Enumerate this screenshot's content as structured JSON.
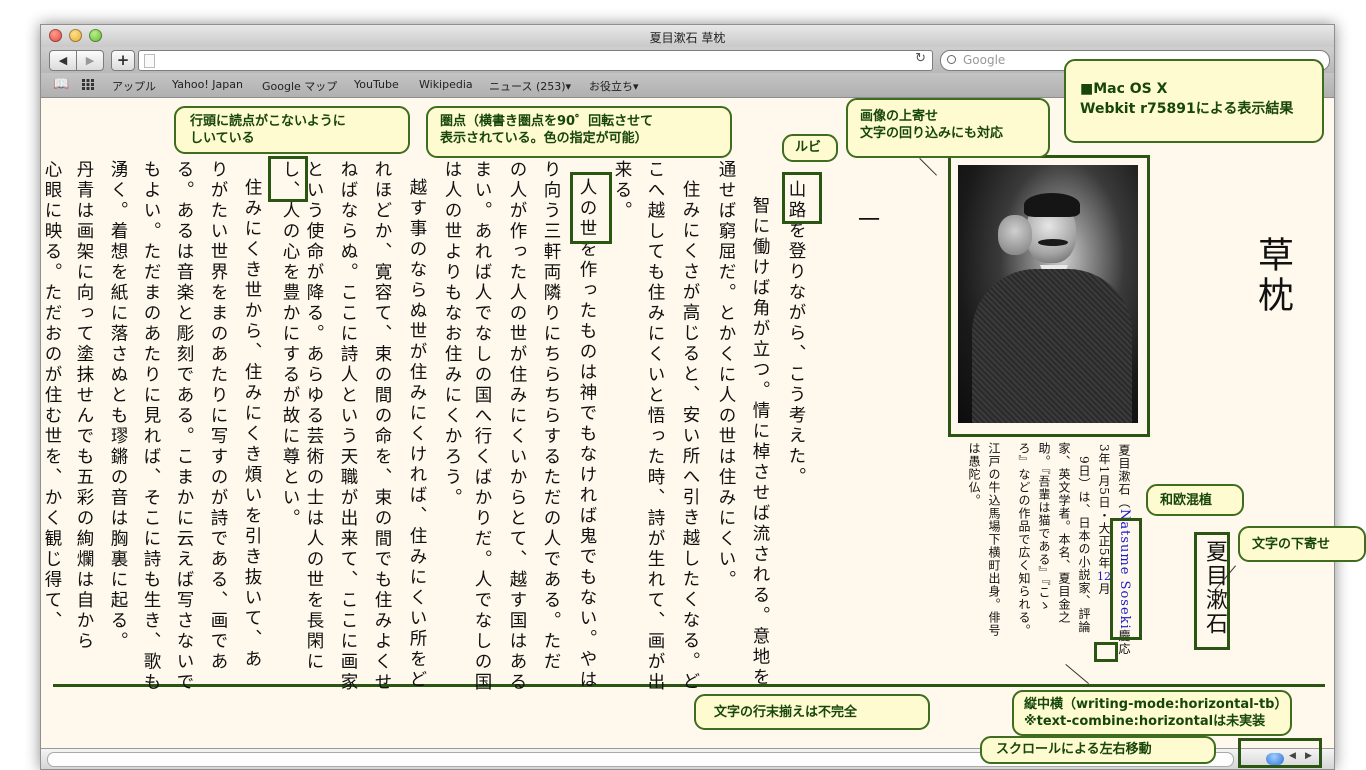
{
  "window": {
    "title": "夏目漱石 草枕"
  },
  "toolbar": {
    "back_glyph": "◀",
    "forward_glyph": "▶",
    "add_glyph": "+",
    "address_value": "",
    "reload_glyph": "↻",
    "search_placeholder": "Google"
  },
  "bookmarks": [
    {
      "label": "アップル"
    },
    {
      "label": "Yahoo! Japan"
    },
    {
      "label": "Google マップ"
    },
    {
      "label": "YouTube"
    },
    {
      "label": "Wikipedia"
    },
    {
      "label": "ニュース (253)▾"
    },
    {
      "label": "お役立ち▾"
    }
  ],
  "book": {
    "title": "草枕",
    "chapter": "一",
    "author_box": "夏目漱石",
    "lines": [
      "山路を登りながら、こう考えた。",
      "智に働けば角が立つ。情に棹させば流される。意地を",
      "通せば窮屈だ。とかくに人の世は住みにくい。",
      "住みにくさが高じると、安い所へ引き越したくなる。ど",
      "こへ越しても住みにくいと悟った時、詩が生れて、画が出",
      "来る。",
      "人の世を作ったものは神でもなければ鬼でもない。やは",
      "り向う三軒両隣りにちらちらするただの人である。ただ",
      "の人が作った人の世が住みにくいからとて、越す国はある",
      "まい。あれば人でなしの国へ行くばかりだ。人でなしの国",
      "は人の世よりもなお住みにくかろう。",
      "越す事のならぬ世が住みにくければ、住みにくい所をど",
      "れほどか、寛容て、束の間の命を、束の間でも住みよくせ",
      "ねばならぬ。ここに詩人という天職が出来て、ここに画家",
      "という使命が降る。あらゆる芸術の士は人の世を長閑に",
      "し、人の心を豊かにするが故に尊とい。",
      "住みにくき世から、住みにくき煩いを引き抜いて、あ",
      "りがたい世界をまのあたりに写すのが詩である、画であ",
      "る。あるは音楽と彫刻である。こまかに云えば写さないで",
      "もよい。ただまのあたりに見れば、そこに詩も生き、歌も",
      "湧く。着想を紙に落さぬとも璆鏘の音は胸裏に起る。",
      "丹青は画架に向って塗抹せんでも五彩の絢爛は自から",
      "心眼に映る。ただおのが住む世を、かく観じ得て、"
    ],
    "caption": {
      "line1_a": "夏目漱石（",
      "line1_name": "Natsume Soseki",
      "line1_b": "慶応",
      "line2_a": "3年1月5日・大正5年",
      "line2_num": "12",
      "line2_b": "月",
      "line3": "9日）は、日本の小説家、評論",
      "line4": "家、英文学者。本名、夏目金之",
      "line5": "助。『吾輩は猫である』『こゝ",
      "line6": "ろ』などの作品で広く知られる。",
      "line7": "江戸の牛込馬場下横町出身。俳号",
      "line8": "は愚陀仏。"
    }
  },
  "callouts": {
    "platform_line1": "■Mac OS X",
    "platform_line2": "Webkit r75891による表示結果",
    "image_float_line1": "画像の上寄せ",
    "image_float_line2": "文字の回り込みにも対応",
    "ruby": "ルビ",
    "emphasis_line1": "圏点（横書き圏点を90゜回転させて",
    "emphasis_line2": "表示されている。色の指定が可能）",
    "kinsoku_line1": "行頭に読点がこないように",
    "kinsoku_line2": "しいている",
    "mixed_text": "和欧混植",
    "bottom_align": "文字の下寄せ",
    "justify": "文字の行末揃えは不完全",
    "tcy_line1": "縦中横（writing-mode:horizontal-tb）",
    "tcy_line2": "※text-combine:horizontalは未実装",
    "scroll": "スクロールによる左右移動"
  },
  "colors": {
    "accent_border": "#3f6d1f",
    "callout_bg": "#fffbd0",
    "page_bg": "#fff8ec",
    "link_blue": "#1a1acc"
  }
}
